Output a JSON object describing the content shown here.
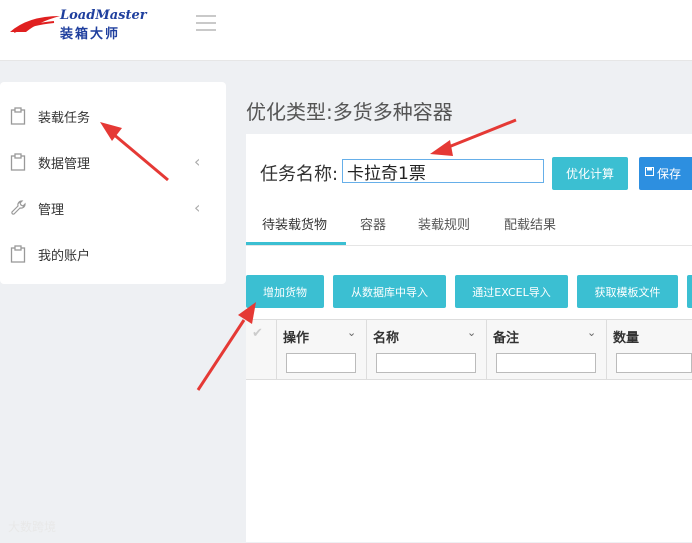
{
  "header": {
    "logo_en": "LoadMaster",
    "logo_cn": "装箱大师",
    "logo_reg": "®",
    "menu_icon": "hamburger-icon"
  },
  "sidebar": {
    "items": [
      {
        "label": "装载任务",
        "icon": "clipboard-icon",
        "chevron": ""
      },
      {
        "label": "数据管理",
        "icon": "clipboard-icon",
        "chevron": "‹"
      },
      {
        "label": "管理",
        "icon": "wrench-icon",
        "chevron": "‹"
      },
      {
        "label": "我的账户",
        "icon": "clipboard-icon",
        "chevron": ""
      }
    ]
  },
  "main": {
    "page_title": "优化类型:多货多种容器",
    "task_name_label": "任务名称:",
    "task_name_value": "卡拉奇1票",
    "optimize_button": "优化计算",
    "save_button": "保存",
    "tabs": [
      {
        "label": "待装载货物",
        "active": true
      },
      {
        "label": "容器",
        "active": false
      },
      {
        "label": "装载规则",
        "active": false
      },
      {
        "label": "配载结果",
        "active": false
      }
    ],
    "toolbar": [
      {
        "label": "增加货物"
      },
      {
        "label": "从数据库中导入"
      },
      {
        "label": "通过EXCEL导入"
      },
      {
        "label": "获取模板文件"
      }
    ],
    "grid_columns": [
      {
        "label": "操作"
      },
      {
        "label": "名称"
      },
      {
        "label": "备注"
      },
      {
        "label": "数量"
      }
    ]
  },
  "watermark": "大数跨境",
  "colors": {
    "accent": "#3bbfd2",
    "save_blue": "#2d8fe0",
    "annotation_red": "#e53935",
    "logo_blue": "#1f3f9e"
  }
}
